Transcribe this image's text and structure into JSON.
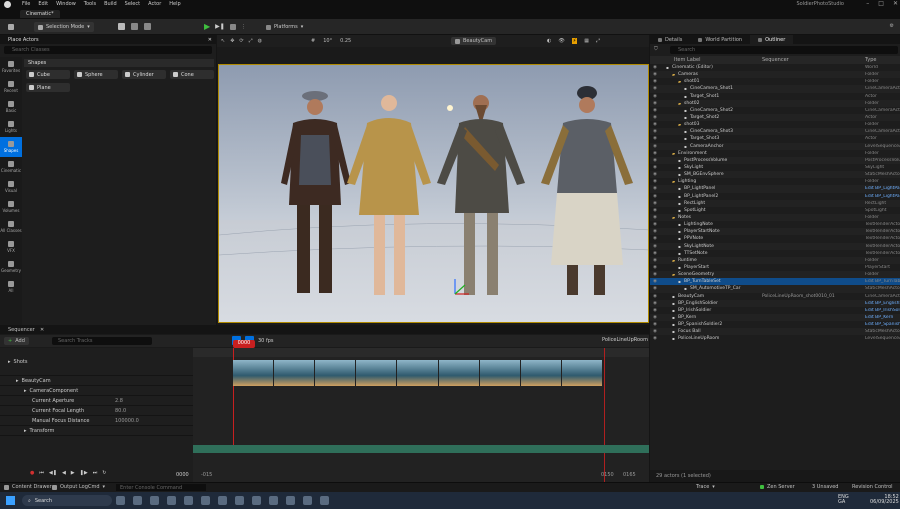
{
  "app": {
    "project": "SoldierPhotoStudio",
    "doc_tab": "Cinematic*"
  },
  "menu": [
    "File",
    "Edit",
    "Window",
    "Tools",
    "Build",
    "Select",
    "Actor",
    "Help"
  ],
  "toolbar": {
    "mode": "Selection Mode",
    "platforms": "Platforms"
  },
  "place_actors": {
    "title": "Place Actors",
    "search_placeholder": "Search Classes",
    "shapes_label": "Shapes",
    "shapes": [
      "Cube",
      "Sphere",
      "Cylinder",
      "Cone",
      "Plane"
    ],
    "side": [
      "Favorites",
      "Recent",
      "Basic",
      "Lights",
      "Shapes",
      "Cinematic",
      "Visual",
      "Volumes",
      "All Classes",
      "VFX",
      "Geometry",
      "All"
    ]
  },
  "viewport": {
    "camera": "BeautyCam",
    "fov": "10°",
    "scale": "0.25",
    "screen_pct": "0.25"
  },
  "sequencer": {
    "title": "Sequencer",
    "add": "Add",
    "search_placeholder": "Search Tracks",
    "fps": "30 fps",
    "seq_name": "PoliceLineUpRoom",
    "frame": "0000",
    "end_frame": "0150",
    "start_label": "-015",
    "label_start": "-015",
    "label_end": "0165",
    "tracks": [
      {
        "name": "Shots",
        "indent": 0
      },
      {
        "name": "BeautyCam",
        "indent": 1
      },
      {
        "name": "CameraComponent",
        "indent": 2
      },
      {
        "name": "Current Aperture",
        "indent": 3,
        "value": "2.8"
      },
      {
        "name": "Current Focal Length",
        "indent": 3,
        "value": "80.0"
      },
      {
        "name": "Manual Focus Distance",
        "indent": 3,
        "value": "100000.0"
      },
      {
        "name": "Transform",
        "indent": 2
      }
    ]
  },
  "right_panel": {
    "tabs": [
      "Details",
      "World Partition",
      "Outliner"
    ],
    "search_placeholder": "Search",
    "col_label": "Item Label",
    "col_seq": "Sequencer",
    "col_type": "Type",
    "footer": "29 actors (1 selected)",
    "outliner": [
      {
        "name": "Cinematic (Editor)",
        "type": "World",
        "indent": 1
      },
      {
        "name": "Cameras",
        "type": "Folder",
        "indent": 2
      },
      {
        "name": "shot01",
        "type": "Folder",
        "indent": 3
      },
      {
        "name": "CineCamera_Shot1",
        "type": "CineCameraActor",
        "indent": 4
      },
      {
        "name": "Target_Shot1",
        "type": "Actor",
        "indent": 4
      },
      {
        "name": "shot02",
        "type": "Folder",
        "indent": 3
      },
      {
        "name": "CineCamera_Shot2",
        "type": "CineCameraActor",
        "indent": 4
      },
      {
        "name": "Target_Shot2",
        "type": "Actor",
        "indent": 4
      },
      {
        "name": "shot03",
        "type": "Folder",
        "indent": 3
      },
      {
        "name": "CineCamera_Shot3",
        "type": "CineCameraActor",
        "indent": 4
      },
      {
        "name": "Target_Shot3",
        "type": "Actor",
        "indent": 4
      },
      {
        "name": "CameraAnchor",
        "type": "LevelSequenceActor",
        "indent": 4
      },
      {
        "name": "Environment",
        "type": "Folder",
        "indent": 2
      },
      {
        "name": "PostProcessVolume",
        "type": "PostProcessVolume",
        "indent": 3
      },
      {
        "name": "SkyLight",
        "type": "SkyLight",
        "indent": 3
      },
      {
        "name": "SM_BGEnvSphere",
        "type": "StaticMeshActor",
        "indent": 3
      },
      {
        "name": "Lighting",
        "type": "Folder",
        "indent": 2
      },
      {
        "name": "BP_LightPanel",
        "type": "Edit BP_LightPanel",
        "indent": 3,
        "blue": true
      },
      {
        "name": "BP_LightPanel2",
        "type": "Edit BP_LightPanel",
        "indent": 3,
        "blue": true
      },
      {
        "name": "RectLight",
        "type": "RectLight",
        "indent": 3
      },
      {
        "name": "SpotLight",
        "type": "SpotLight",
        "indent": 3
      },
      {
        "name": "Notes",
        "type": "Folder",
        "indent": 2
      },
      {
        "name": "LightingNote",
        "type": "TextRenderActor",
        "indent": 3
      },
      {
        "name": "PlayerStartNote",
        "type": "TextRenderActor",
        "indent": 3
      },
      {
        "name": "PPVNote",
        "type": "TextRenderActor",
        "indent": 3
      },
      {
        "name": "SkyLightNote",
        "type": "TextRenderActor",
        "indent": 3
      },
      {
        "name": "TTSetNote",
        "type": "TextRenderActor",
        "indent": 3
      },
      {
        "name": "Runtime",
        "type": "Folder",
        "indent": 2
      },
      {
        "name": "PlayerStart",
        "type": "PlayerStart",
        "indent": 3
      },
      {
        "name": "SceneGeometry",
        "type": "Folder",
        "indent": 2
      },
      {
        "name": "BP_TurnTableSet",
        "type": "Edit BP_TurnTabl",
        "indent": 3,
        "sel": true
      },
      {
        "name": "SM_AutomotiveTP_Car",
        "type": "StaticMeshActor",
        "indent": 4
      },
      {
        "name": "BeautyCam",
        "type": "CineCameraActor",
        "indent": 2,
        "seq": "PoliceLineUpRoom_shot0010_01"
      },
      {
        "name": "BP_EnglishSoldier",
        "type": "Edit BP_EnglishS",
        "indent": 2,
        "blue": true
      },
      {
        "name": "BP_IrishSoldier",
        "type": "Edit BP_IrishSold",
        "indent": 2,
        "blue": true
      },
      {
        "name": "BP_Kern",
        "type": "Edit BP_Kern",
        "indent": 2,
        "blue": true
      },
      {
        "name": "BP_SpanishSoldier2",
        "type": "Edit BP_SpanishS",
        "indent": 2,
        "blue": true
      },
      {
        "name": "Focus Ball",
        "type": "StaticMeshActor",
        "indent": 2
      },
      {
        "name": "PoliceLineUpRoom",
        "type": "LevelSequenceActor",
        "indent": 2
      }
    ]
  },
  "status": {
    "content_drawer": "Content Drawer",
    "output_log": "Output Log",
    "cmd": "Cmd",
    "cmd_placeholder": "Enter Console Command",
    "trace": "Trace",
    "derived": "Zen Server",
    "unsaved": "3 Unsaved",
    "revision": "Revision Control"
  },
  "taskbar": {
    "search": "Search",
    "lang": "ENG",
    "region": "GA",
    "time": "18:52",
    "date": "06/09/2025"
  },
  "colors": {
    "accent": "#0070e0",
    "selected_row": "#0f4c8a",
    "play": "#3fbf3f"
  }
}
